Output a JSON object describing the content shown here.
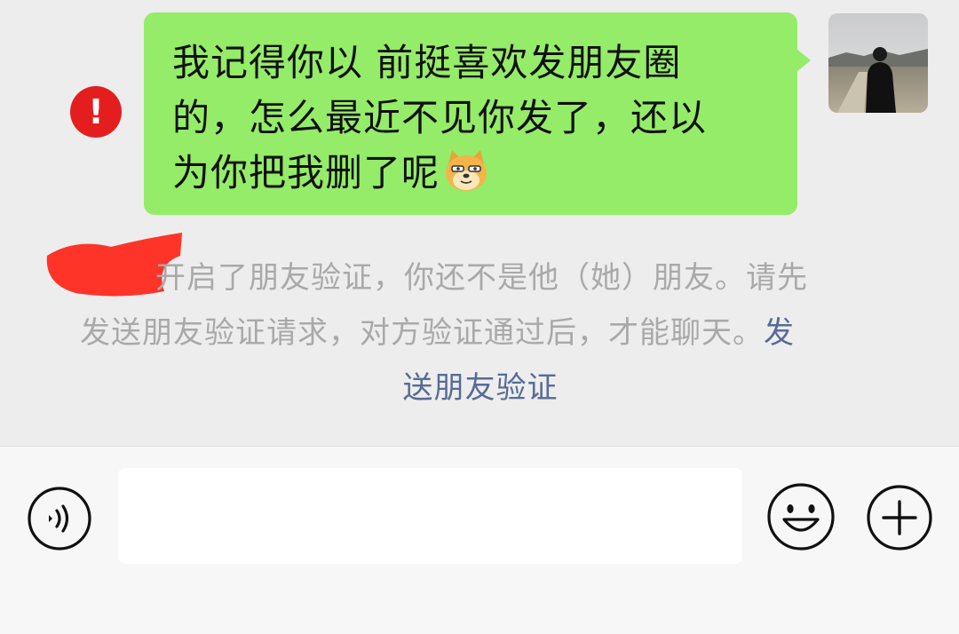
{
  "message": {
    "lines": [
      "我记得你以 前挺喜欢发朋友圈",
      "的，怎么最近不见你发了，还以",
      "为你把我删了呢"
    ],
    "emoji": "doge-emoji",
    "status": "send-failed-icon"
  },
  "system_notice": {
    "line1": "开启了朋友验证，你还不是他（她）朋友。请先",
    "line2": "发送朋友验证请求，对方验证通过后，才能聊天。",
    "link_part1": "发",
    "link_part2": "送朋友验证"
  },
  "input_bar": {
    "voice_icon": "voice-icon",
    "emoji_icon": "smiley-icon",
    "plus_icon": "plus-icon",
    "input_value": ""
  },
  "colors": {
    "bubble": "#95ec69",
    "error": "#e41e1e",
    "link": "#576b95",
    "system_text": "#a9a9a9"
  }
}
